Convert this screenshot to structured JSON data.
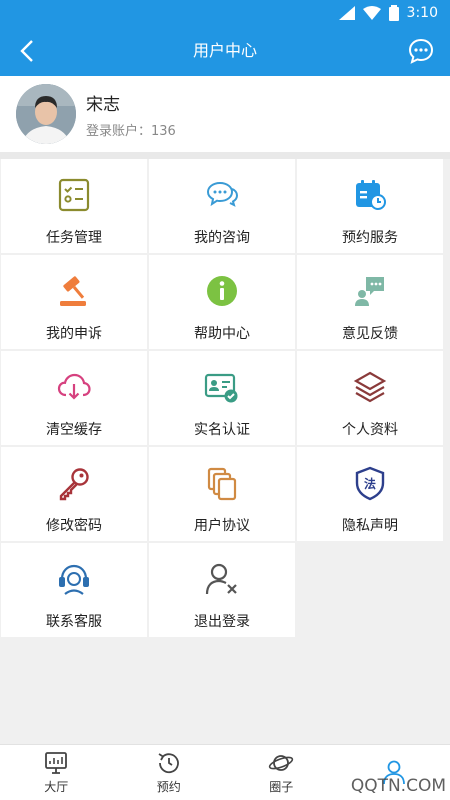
{
  "status_bar": {
    "time": "3:10",
    "icons": [
      "signal-icon",
      "wifi-icon",
      "battery-icon"
    ]
  },
  "app_bar": {
    "title": "用户中心",
    "back_icon": "back-arrow-icon",
    "action_icon": "chat-bubble-icon"
  },
  "profile": {
    "name": "宋志",
    "account": "登录账户：136"
  },
  "menu": {
    "items": [
      {
        "label": "任务管理",
        "icon": "task-list-icon",
        "color": "#8b8b2e"
      },
      {
        "label": "我的咨询",
        "icon": "chat-bubbles-icon",
        "color": "#3a9bd5"
      },
      {
        "label": "预约服务",
        "icon": "calendar-clock-icon",
        "color": "#2196e3"
      },
      {
        "label": "我的申诉",
        "icon": "gavel-icon",
        "color": "#ef7d3c"
      },
      {
        "label": "帮助中心",
        "icon": "info-icon",
        "color": "#7cc242"
      },
      {
        "label": "意见反馈",
        "icon": "feedback-icon",
        "color": "#7fb8a6"
      },
      {
        "label": "清空缓存",
        "icon": "cloud-download-icon",
        "color": "#d6417f"
      },
      {
        "label": "实名认证",
        "icon": "id-card-check-icon",
        "color": "#3a9c85"
      },
      {
        "label": "个人资料",
        "icon": "layers-icon",
        "color": "#8a3a3a"
      },
      {
        "label": "修改密码",
        "icon": "key-icon",
        "color": "#a8343a"
      },
      {
        "label": "用户协议",
        "icon": "documents-icon",
        "color": "#d08a43"
      },
      {
        "label": "隐私声明",
        "icon": "law-shield-icon",
        "color": "#2d3f8c"
      },
      {
        "label": "联系客服",
        "icon": "headset-icon",
        "color": "#2d6fb0"
      },
      {
        "label": "退出登录",
        "icon": "user-logout-icon",
        "color": "#555555"
      }
    ]
  },
  "tabs": [
    {
      "label": "大厅",
      "icon": "hall-icon",
      "active": false
    },
    {
      "label": "预约",
      "icon": "history-clock-icon",
      "active": false
    },
    {
      "label": "圈子",
      "icon": "planet-icon",
      "active": false
    },
    {
      "label": "",
      "icon": "user-icon",
      "active": true
    }
  ],
  "watermark": "QQTN.COM",
  "colors": {
    "primary": "#2196e3",
    "background": "#f0f0f0"
  }
}
